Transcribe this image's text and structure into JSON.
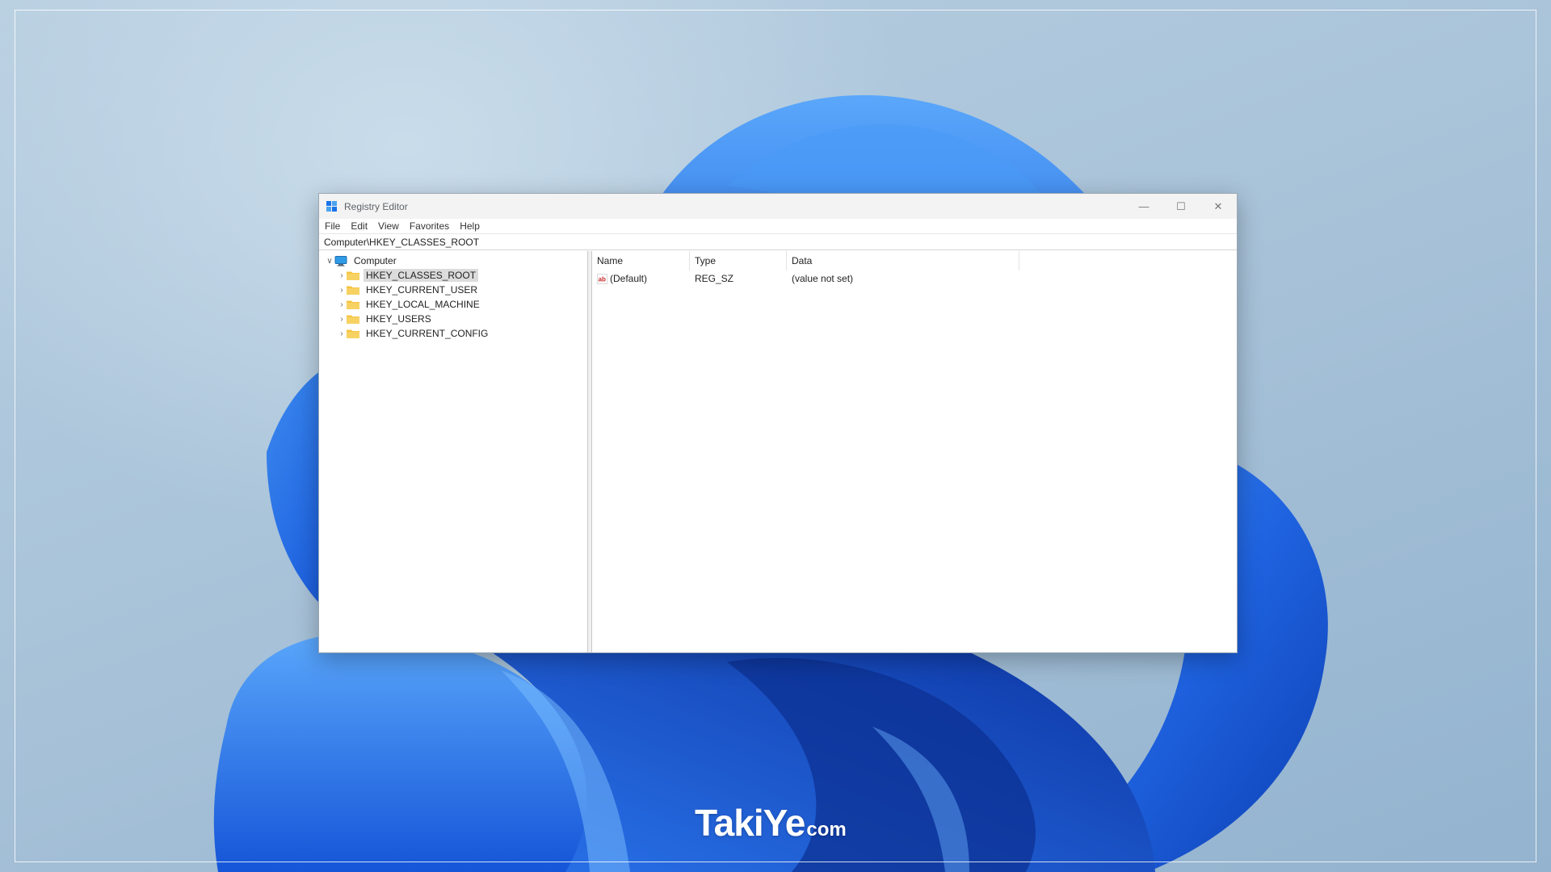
{
  "window": {
    "title": "Registry Editor",
    "controls": {
      "minimize": "—",
      "maximize": "☐",
      "close": "✕"
    }
  },
  "menu": [
    "File",
    "Edit",
    "View",
    "Favorites",
    "Help"
  ],
  "address": "Computer\\HKEY_CLASSES_ROOT",
  "tree": {
    "root": {
      "label": "Computer",
      "expanded": true
    },
    "keys": [
      {
        "label": "HKEY_CLASSES_ROOT",
        "selected": true
      },
      {
        "label": "HKEY_CURRENT_USER",
        "selected": false
      },
      {
        "label": "HKEY_LOCAL_MACHINE",
        "selected": false
      },
      {
        "label": "HKEY_USERS",
        "selected": false
      },
      {
        "label": "HKEY_CURRENT_CONFIG",
        "selected": false
      }
    ]
  },
  "list": {
    "columns": [
      "Name",
      "Type",
      "Data"
    ],
    "rows": [
      {
        "name": "(Default)",
        "type": "REG_SZ",
        "data": "(value not set)",
        "icon": "string-value-icon"
      }
    ]
  },
  "watermark": {
    "main": "TakiYe",
    "suffix": "com"
  },
  "colors": {
    "accent": "#1a73e8",
    "folder": "#f4c542",
    "selection": "#dcdcdc"
  }
}
